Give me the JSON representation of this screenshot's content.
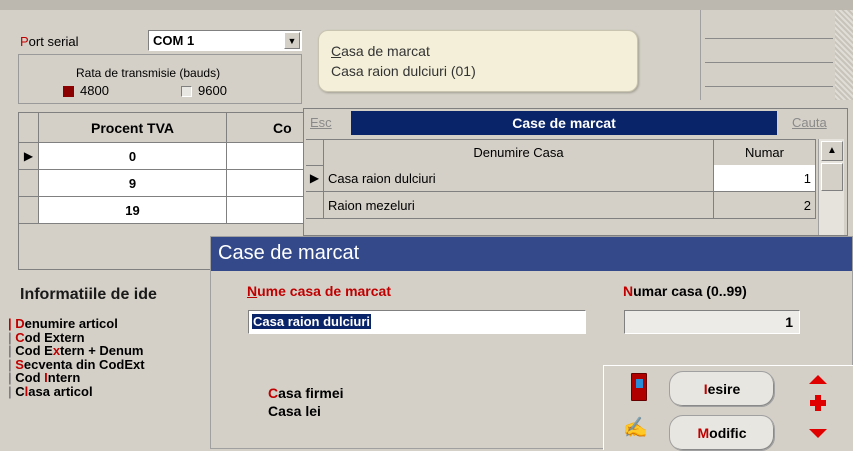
{
  "port": {
    "label": "Port serial",
    "label_first": "P",
    "label_rest": "ort serial",
    "value": "COM 1",
    "rate_label": "Rata de transmisie (bauds)",
    "rate_4800": "4800",
    "rate_9600": "9600"
  },
  "vat_table": {
    "headers": [
      "Procent TVA",
      "Co"
    ],
    "rows": [
      "0",
      "9",
      "19"
    ]
  },
  "info": {
    "title": "Informatiile de ide",
    "options": [
      {
        "first": "D",
        "rest": "enumire articol"
      },
      {
        "first": "C",
        "rest": "od Extern"
      },
      {
        "pre": "Cod E",
        "first": "x",
        "rest": "tern + Denum"
      },
      {
        "first": "S",
        "rest": "ecventa din CodExt"
      },
      {
        "pre": "Cod ",
        "first": "I",
        "rest": "ntern"
      },
      {
        "pre": "C",
        "first": "l",
        "rest": "asa articol"
      }
    ]
  },
  "tooltip": {
    "line1": "Casa de marcat",
    "line2": "Casa raion dulciuri (01)"
  },
  "grid_window": {
    "esc_label": "Esc",
    "title": "Case de marcat",
    "search_label": "Cauta",
    "col_name": "Denumire Casa",
    "col_number": "Numar",
    "rows": [
      {
        "name": "Casa raion dulciuri",
        "number": "1"
      },
      {
        "name": "Raion mezeluri",
        "number": "2"
      }
    ]
  },
  "form": {
    "title": "Case de marcat",
    "name_label": "Nume casa de marcat",
    "name_value": "Casa raion dulciuri",
    "number_label": "Numar  casa (0..99)",
    "number_value": "1",
    "info_line1": "Casa firmei",
    "info_line2": "Casa lei",
    "exit_button": "Iesire",
    "modify_button": "Modific"
  },
  "colors": {
    "title_blue": "#0a246a",
    "accent_red": "#c00000",
    "tooltip_bg": "#f3efd8",
    "form_title_bg": "#34498a"
  }
}
